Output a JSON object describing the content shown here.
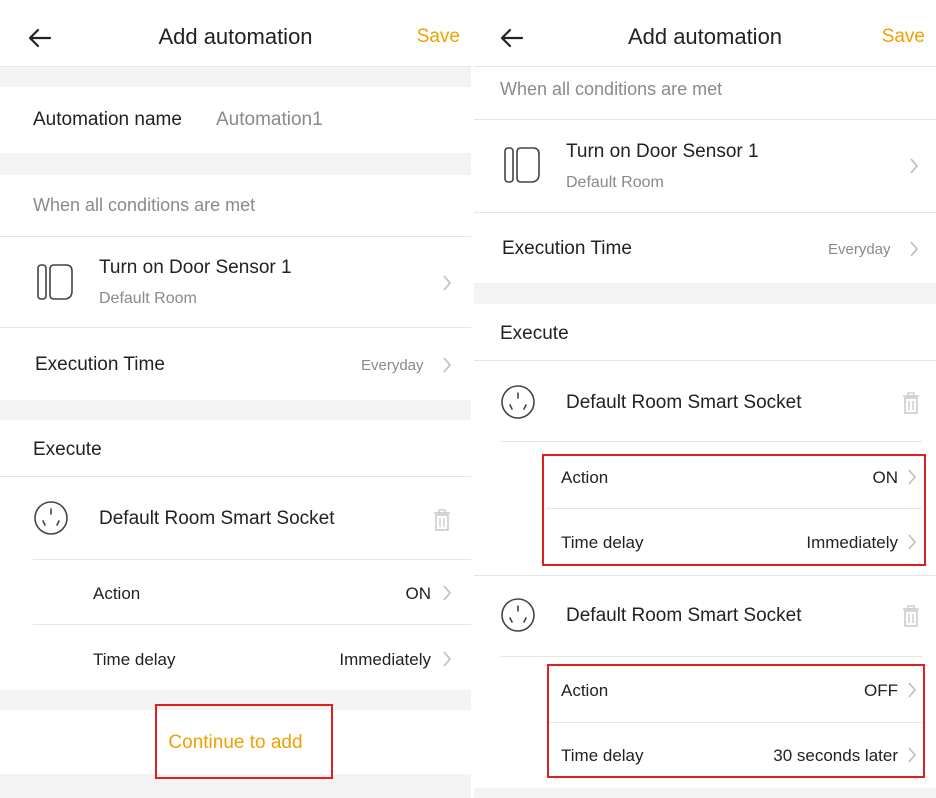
{
  "screens": [
    {
      "header": {
        "title": "Add automation",
        "save_label": "Save",
        "back_icon": "arrow-left-icon"
      },
      "automation_name": {
        "label": "Automation name",
        "value": "Automation1"
      },
      "conditions_heading": "When all conditions are met",
      "condition": {
        "title": "Turn on Door Sensor 1",
        "subtitle": "Default Room",
        "icon": "door-sensor-icon"
      },
      "execution_time": {
        "label": "Execution Time",
        "value": "Everyday"
      },
      "execute_heading": "Execute",
      "tasks": [
        {
          "device": "Default Room Smart Socket",
          "icon": "socket-icon",
          "action_label": "Action",
          "action_value": "ON",
          "delay_label": "Time delay",
          "delay_value": "Immediately"
        }
      ],
      "continue_label": "Continue to add"
    },
    {
      "header": {
        "title": "Add automation",
        "save_label": "Save",
        "back_icon": "arrow-left-icon"
      },
      "conditions_heading": "When all conditions are met",
      "condition": {
        "title": "Turn on Door Sensor 1",
        "subtitle": "Default Room",
        "icon": "door-sensor-icon"
      },
      "execution_time": {
        "label": "Execution Time",
        "value": "Everyday"
      },
      "execute_heading": "Execute",
      "tasks": [
        {
          "device": "Default Room Smart Socket",
          "icon": "socket-icon",
          "action_label": "Action",
          "action_value": "ON",
          "delay_label": "Time delay",
          "delay_value": "Immediately"
        },
        {
          "device": "Default Room Smart Socket",
          "icon": "socket-icon",
          "action_label": "Action",
          "action_value": "OFF",
          "delay_label": "Time delay",
          "delay_value": "30 seconds later"
        }
      ]
    }
  ],
  "colors": {
    "accent": "#f0a000",
    "highlight": "#e02020",
    "separator": "#f3f3f3"
  }
}
